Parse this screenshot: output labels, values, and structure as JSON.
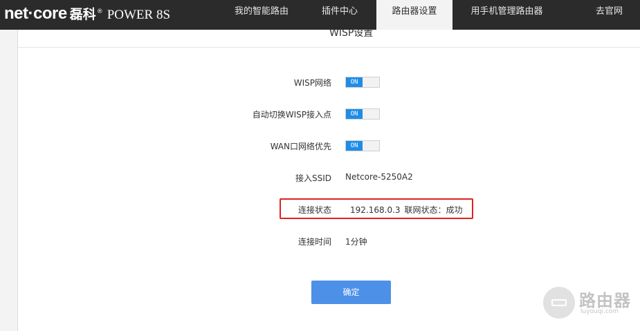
{
  "brand": {
    "logo": "net·core",
    "cn_name": "磊科",
    "reg": "®",
    "model": "POWER 8S"
  },
  "nav": {
    "tabs": [
      {
        "label": "我的智能路由"
      },
      {
        "label": "插件中心"
      },
      {
        "label": "路由器设置",
        "active": true
      },
      {
        "label": "用手机管理路由器"
      },
      {
        "label": "去官网"
      }
    ]
  },
  "panel": {
    "title": "WISP设置"
  },
  "form": {
    "wisp": {
      "label": "WISP网络",
      "toggle": "ON"
    },
    "auto_switch": {
      "label": "自动切换WISP接入点",
      "toggle": "ON"
    },
    "wan_priority": {
      "label": "WAN口网络优先",
      "toggle": "ON"
    },
    "ssid": {
      "label": "接入SSID",
      "value": "Netcore-5250A2"
    },
    "conn_status": {
      "label": "连接状态",
      "ip": "192.168.0.3",
      "net_status": "联网状态：成功"
    },
    "conn_time": {
      "label": "连接时间",
      "value": "1分钟"
    }
  },
  "confirm_button": "确定",
  "watermark": {
    "text": "路由器",
    "sub": "luyouqi.com"
  },
  "colors": {
    "topbar": "#2b2b2b",
    "toggle_on": "#1e8de6",
    "button": "#4d90e8",
    "highlight": "#e02020"
  }
}
